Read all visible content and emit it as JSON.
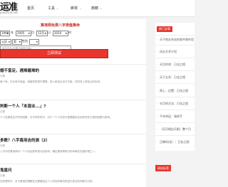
{
  "header": {
    "logo": "运准",
    "logo_url": "yunzhun.net",
    "nav": [
      {
        "label": "首页",
        "has_dropdown": false
      },
      {
        "label": "工具",
        "has_dropdown": true
      },
      {
        "label": "麻将",
        "has_dropdown": true
      },
      {
        "label": "典籍",
        "has_dropdown": true
      }
    ]
  },
  "form": {
    "title": "算准网免费八字排盘算命",
    "year": "1990",
    "month": "2005",
    "day": "12月",
    "hour": "2010",
    "calendar": "公历",
    "gender": "男",
    "gender_label": "性别",
    "year_suffix": "年",
    "month_suffix": "月",
    "day_suffix": "日",
    "hour_suffix": "时",
    "name_placeholder": "填写姓名(如果不填就没事)",
    "submit_label": "立即测试"
  },
  "articles": [
    {
      "title": "婚不富足，遇难最难的",
      "date": "日期",
      "text": "缺少命，在天命中保留，保管家境很不理想，收入和支出也不平衡，在财务上有较大的负担。"
    },
    {
      "title": "判断一个人「本混业...」?",
      "date": "日期",
      "text": "个人发展混合不同的因素，在不同环境中，对于一个人的评价更需要综合地考虑多方面的因素与影响。"
    },
    {
      "title": "多数？八字喜用吉的测（2）",
      "date": "日期",
      "text": "八字中的喜用神对一个人的运势有很大的影响，确定喜用神是分析命局的关键步骤之一。"
    },
    {
      "title": "鬼星问",
      "date": "日期",
      "text": "在命理学中，对于星宿的理解往往需要结合个人的实际情况来进行综合的判断与分析。"
    }
  ],
  "sidebar": {
    "heading": "热门文章",
    "items": [
      "天干地支合化的条件和作用",
      "风水方术介绍",
      "天生的命：已化之相",
      "天干五合：已化之相",
      "两上…位置：已化之相",
      "半月的方法：已化之相",
      "千年命运：易经手",
      "（历月相应天斛）整个月",
      "正确吗(女）：已化之相"
    ],
    "footer_label": "网站标签"
  }
}
